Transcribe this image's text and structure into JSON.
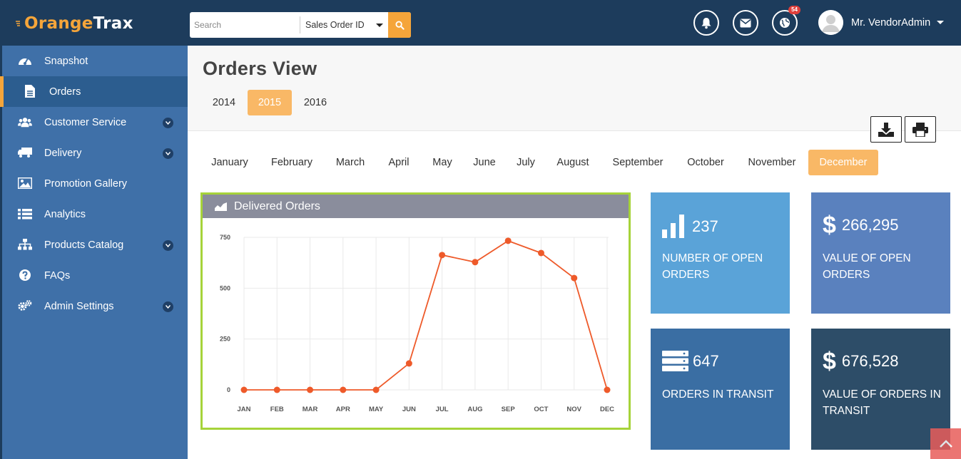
{
  "app": {
    "logo_o": "O",
    "logo_mid": "range",
    "logo_end": "Trax"
  },
  "search": {
    "placeholder": "Search",
    "field_selected": "Sales Order ID"
  },
  "header": {
    "notification_badge": "54",
    "user_name": "Mr. VendorAdmin"
  },
  "sidebar": {
    "items": [
      {
        "label": "Snapshot",
        "icon": "dashboard-icon"
      },
      {
        "label": "Orders",
        "icon": "document-icon"
      },
      {
        "label": "Customer Service",
        "icon": "users-icon"
      },
      {
        "label": "Delivery",
        "icon": "truck-icon"
      },
      {
        "label": "Promotion Gallery",
        "icon": "picture-icon"
      },
      {
        "label": "Analytics",
        "icon": "list-icon"
      },
      {
        "label": "Products Catalog",
        "icon": "sitemap-icon"
      },
      {
        "label": "FAQs",
        "icon": "question-icon"
      },
      {
        "label": "Admin Settings",
        "icon": "cogs-icon"
      }
    ],
    "active": "Orders"
  },
  "page": {
    "title": "Orders View",
    "years": [
      "2014",
      "2015",
      "2016"
    ],
    "active_year": "2015",
    "months": [
      "January",
      "February",
      "March",
      "April",
      "May",
      "June",
      "July",
      "August",
      "September",
      "October",
      "November",
      "December"
    ],
    "active_month": "December"
  },
  "panel": {
    "title": "Delivered Orders"
  },
  "chart_data": {
    "type": "line",
    "title": "Delivered Orders",
    "categories": [
      "JAN",
      "FEB",
      "MAR",
      "APR",
      "MAY",
      "JUN",
      "JUL",
      "AUG",
      "SEP",
      "OCT",
      "NOV",
      "DEC"
    ],
    "values": [
      0,
      0,
      0,
      0,
      0,
      130,
      663,
      628,
      733,
      673,
      550,
      0
    ],
    "yticks": [
      0,
      250,
      500,
      750
    ],
    "ylim": [
      0,
      750
    ],
    "grid": true,
    "color": "#ee5a2a"
  },
  "stats": [
    {
      "value": "237",
      "label_line1": "NUMBER OF OPEN",
      "label_line2": "ORDERS",
      "icon": "bar-chart-icon",
      "color": "#5aa3d8"
    },
    {
      "value": "266,295",
      "label_line1": "VALUE OF OPEN",
      "label_line2": "ORDERS",
      "icon": "dollar-icon",
      "symbol": "$",
      "color": "#5a81be"
    },
    {
      "value": "647",
      "label_line1": "ORDERS IN TRANSIT",
      "label_line2": "",
      "icon": "server-icon",
      "color": "#3a6ea3"
    },
    {
      "value": "676,528",
      "label_line1": "VALUE OF ORDERS IN",
      "label_line2": "TRANSIT",
      "icon": "dollar-icon",
      "symbol": "$",
      "color": "#2d4d68"
    }
  ]
}
